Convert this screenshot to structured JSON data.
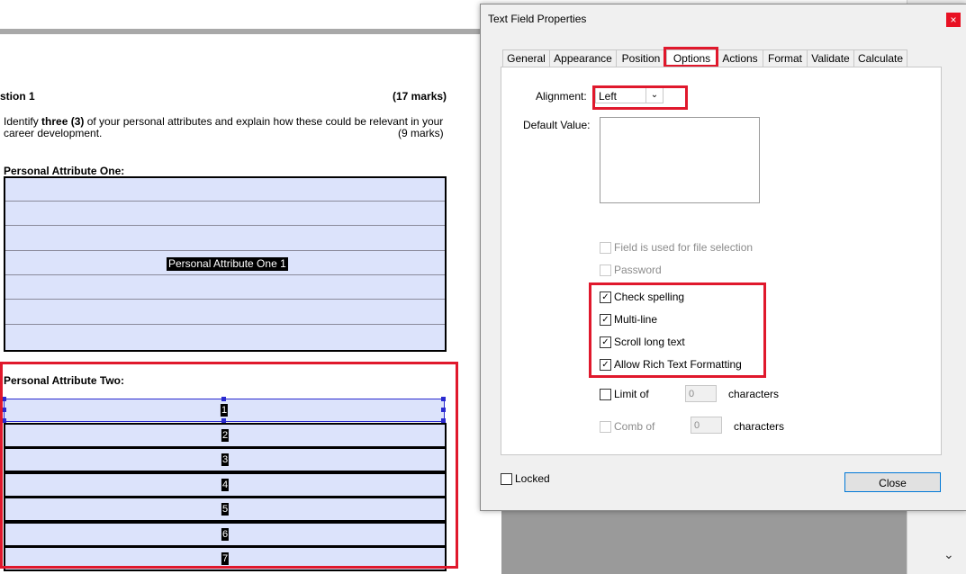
{
  "document": {
    "question_title": "stion 1",
    "question_marks": "(17 marks)",
    "instruction_line1_pre": "Identify ",
    "instruction_line1_bold": "three (3)",
    "instruction_line1_post": " of your personal attributes and explain how these could be relevant in your",
    "instruction_line2": "career development.",
    "instruction_marks": "(9 marks)",
    "attr_one_heading": "Personal Attribute One:",
    "attr_one_field_label": "Personal Attribute One 1",
    "attr_two_heading": "Personal Attribute Two:",
    "attr_two_rows": [
      "1",
      "2",
      "3",
      "4",
      "5",
      "6",
      "7"
    ]
  },
  "dialog": {
    "title": "Text Field Properties",
    "close_glyph": "×",
    "tabs": [
      "General",
      "Appearance",
      "Position",
      "Options",
      "Actions",
      "Format",
      "Validate",
      "Calculate"
    ],
    "active_tab": "Options",
    "alignment_label": "Alignment:",
    "alignment_value": "Left",
    "default_value_label": "Default Value:",
    "checkboxes": [
      {
        "label": "Field is used for file selection",
        "checked": false,
        "disabled": true
      },
      {
        "label": "Password",
        "checked": false,
        "disabled": true
      },
      {
        "label": "Check spelling",
        "checked": true,
        "disabled": false
      },
      {
        "label": "Multi-line",
        "checked": true,
        "disabled": false
      },
      {
        "label": "Scroll long text",
        "checked": true,
        "disabled": false
      },
      {
        "label": "Allow Rich Text Formatting",
        "checked": true,
        "disabled": false
      }
    ],
    "limit_of_label": "Limit of",
    "limit_value": "0",
    "limit_units": "characters",
    "comb_of_label": "Comb of",
    "comb_value": "0",
    "comb_units": "characters",
    "locked_label": "Locked",
    "close_button": "Close"
  },
  "colors": {
    "highlight": "#e0182c",
    "field_fill": "#dce3fb",
    "selection": "#2a2ad0"
  }
}
